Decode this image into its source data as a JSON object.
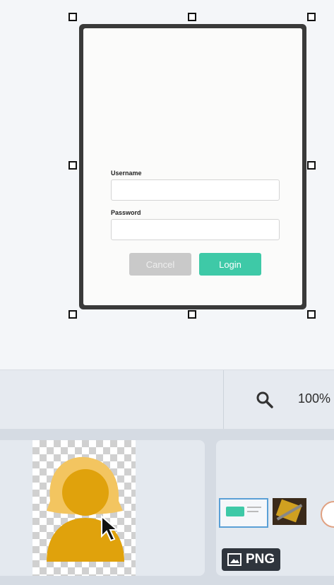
{
  "login_form": {
    "username_label": "Username",
    "password_label": "Password",
    "cancel_label": "Cancel",
    "login_label": "Login"
  },
  "toolbar": {
    "zoom_label": "100%",
    "zoom_icon": "search-icon"
  },
  "assets": [
    {
      "type": "avatar-image",
      "icon": "user-silhouette"
    },
    {
      "type": "screenshot",
      "badge_label": "PNG",
      "badge_icon": "image-icon"
    }
  ],
  "colors": {
    "accent": "#3ec9a7",
    "cancel": "#c9c9c9",
    "avatar": "#e0a20c",
    "avatar_hair": "#f3c560"
  }
}
